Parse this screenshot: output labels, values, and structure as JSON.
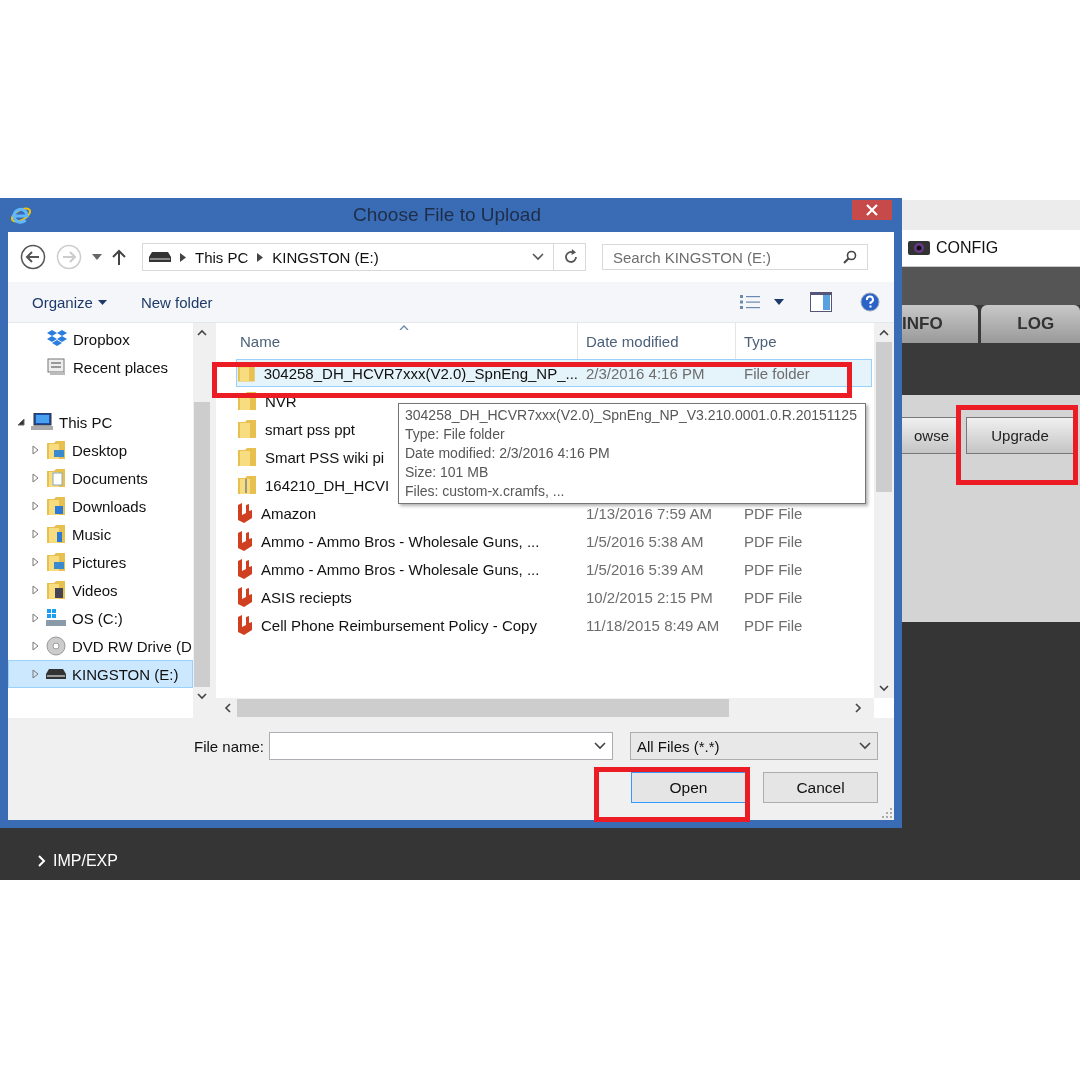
{
  "app": {
    "header_title": "CONFIG",
    "tabs": [
      "INFO",
      "LOG"
    ],
    "buttons": [
      "owse",
      "Upgrade"
    ],
    "menu_items": [
      "IMP/EXP"
    ]
  },
  "dialog": {
    "title": "Choose File to Upload",
    "address": [
      "This PC",
      "KINGSTON (E:)"
    ],
    "search": {
      "placeholder": "Search KINGSTON (E:)"
    },
    "toolbar": {
      "organize": "Organize",
      "new_folder": "New folder"
    },
    "nav": [
      {
        "label": "Dropbox",
        "kind": "dropbox",
        "selected": false
      },
      {
        "label": "Recent places",
        "kind": "recent",
        "selected": false
      },
      {
        "label": "This PC",
        "kind": "pc",
        "selected": false,
        "expanded": true,
        "children": [
          {
            "label": "Desktop",
            "kind": "desktop",
            "selected": false,
            "expanded": false
          },
          {
            "label": "Documents",
            "kind": "documents",
            "selected": false,
            "expanded": false
          },
          {
            "label": "Downloads",
            "kind": "downloads",
            "selected": false,
            "expanded": false
          },
          {
            "label": "Music",
            "kind": "music",
            "selected": false,
            "expanded": false
          },
          {
            "label": "Pictures",
            "kind": "pictures",
            "selected": false,
            "expanded": false
          },
          {
            "label": "Videos",
            "kind": "videos",
            "selected": false,
            "expanded": false
          },
          {
            "label": "OS (C:)",
            "kind": "drive",
            "selected": false,
            "expanded": false
          },
          {
            "label": "DVD RW Drive (D",
            "kind": "disc",
            "selected": false,
            "expanded": false
          },
          {
            "label": "KINGSTON (E:)",
            "kind": "usb",
            "selected": true,
            "expanded": false
          }
        ]
      }
    ],
    "columns": [
      "Name",
      "Date modified",
      "Type"
    ],
    "rows": [
      {
        "name": "304258_DH_HCVR7xxx(V2.0)_SpnEng_NP_...",
        "date": "2/3/2016 4:16 PM",
        "type": "File folder",
        "kind": "folder",
        "selected": true
      },
      {
        "name": "NVR",
        "kind": "folder",
        "selected": false
      },
      {
        "name": "smart pss ppt",
        "kind": "folder",
        "selected": false
      },
      {
        "name": "Smart PSS wiki pi",
        "kind": "folder",
        "selected": false
      },
      {
        "name": "164210_DH_HCVI",
        "kind": "zip",
        "selected": false
      },
      {
        "name": "Amazon",
        "date": "1/13/2016 7:59 AM",
        "type": "PDF File",
        "kind": "pdf",
        "selected": false
      },
      {
        "name": "Ammo  - Ammo Bros - Wholesale Guns, ...",
        "date": "1/5/2016 5:38 AM",
        "type": "PDF File",
        "kind": "pdf",
        "selected": false
      },
      {
        "name": "Ammo  - Ammo Bros - Wholesale Guns, ...",
        "date": "1/5/2016 5:39 AM",
        "type": "PDF File",
        "kind": "pdf",
        "selected": false
      },
      {
        "name": "ASIS reciepts",
        "date": "10/2/2015 2:15 PM",
        "type": "PDF File",
        "kind": "pdf",
        "selected": false
      },
      {
        "name": "Cell Phone Reimbursement Policy - Copy",
        "date": "11/18/2015 8:49 AM",
        "type": "PDF File",
        "kind": "pdf",
        "selected": false
      }
    ],
    "tooltip": [
      "304258_DH_HCVR7xxx(V2.0)_SpnEng_NP_V3.210.0001.0.R.20151125",
      "Type: File folder",
      "Date modified: 2/3/2016 4:16 PM",
      "Size: 101 MB",
      "Files: custom-x.cramfs, ..."
    ],
    "file_name_label": "File name:",
    "filter": "All Files (*.*)",
    "buttons": [
      "Open",
      "Cancel"
    ]
  }
}
